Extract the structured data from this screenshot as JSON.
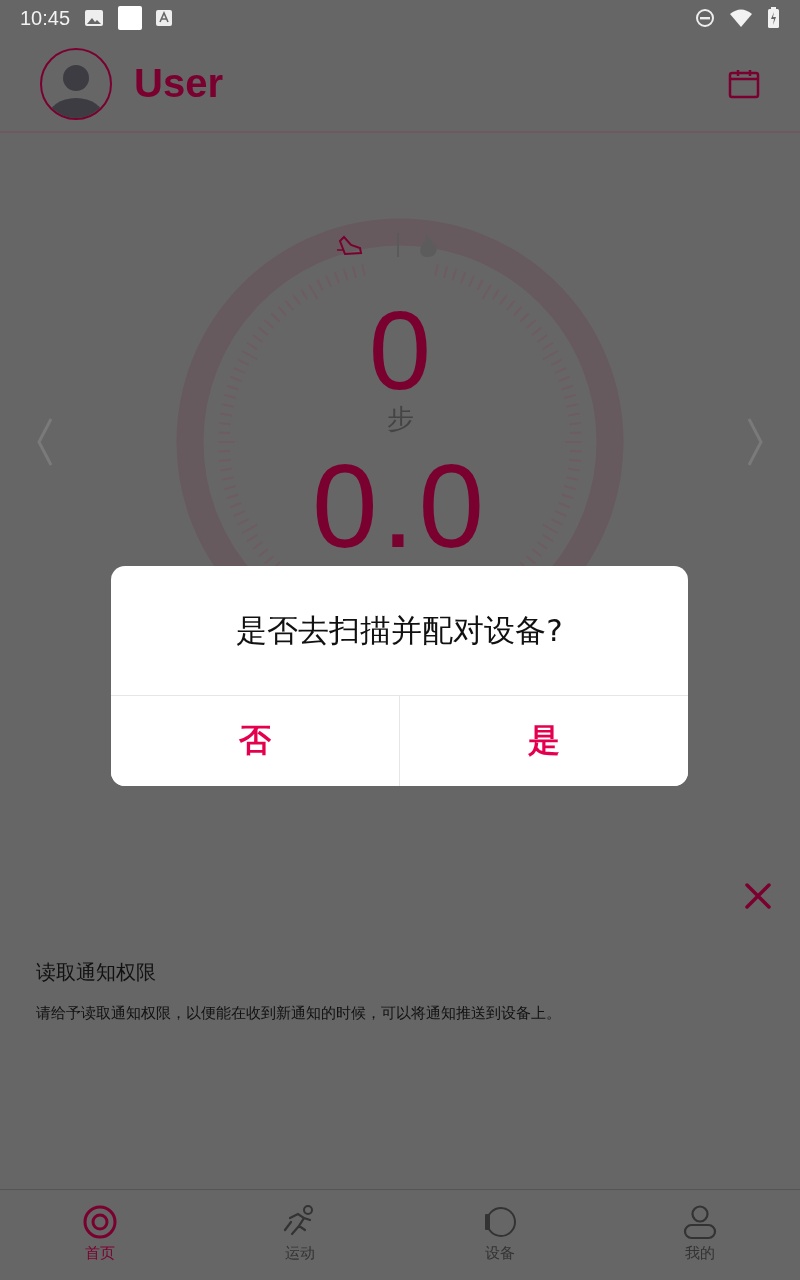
{
  "status_bar": {
    "time": "10:45"
  },
  "header": {
    "title": "User"
  },
  "gauge": {
    "steps": "0",
    "steps_unit": "步",
    "calories": "0.0"
  },
  "notice": {
    "title": "读取通知权限",
    "text": "请给予读取通知权限，以便能在收到新通知的时候，可以将通知推送到设备上。"
  },
  "dialog": {
    "message": "是否去扫描并配对设备?",
    "buttons": [
      "否",
      "是"
    ]
  },
  "nav": [
    {
      "label": "首页",
      "kind": "home",
      "selected": true
    },
    {
      "label": "运动",
      "kind": "sport",
      "selected": false
    },
    {
      "label": "设备",
      "kind": "device",
      "selected": false
    },
    {
      "label": "我的",
      "kind": "me",
      "selected": false
    }
  ]
}
